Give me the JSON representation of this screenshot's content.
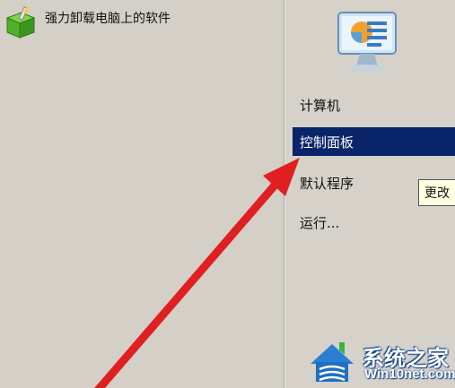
{
  "left_pane": {
    "app_item": {
      "label": "强力卸载电脑上的软件",
      "icon": "green-box-uninstall-icon"
    }
  },
  "right_pane": {
    "icon": "control-panel-icon",
    "menu": [
      {
        "label": "计算机",
        "selected": false
      },
      {
        "label": "控制面板",
        "selected": true
      },
      {
        "label": "默认程序",
        "selected": false
      },
      {
        "label": "运行...",
        "selected": false
      }
    ],
    "tooltip": "更改"
  },
  "annotation": {
    "arrow_color": "#e02020"
  },
  "watermark": {
    "brand": "系统之家",
    "url": "Win10net.com",
    "icon": "house-logo-icon"
  },
  "colors": {
    "selection": "#0a246a",
    "background": "#d4d0c8"
  }
}
